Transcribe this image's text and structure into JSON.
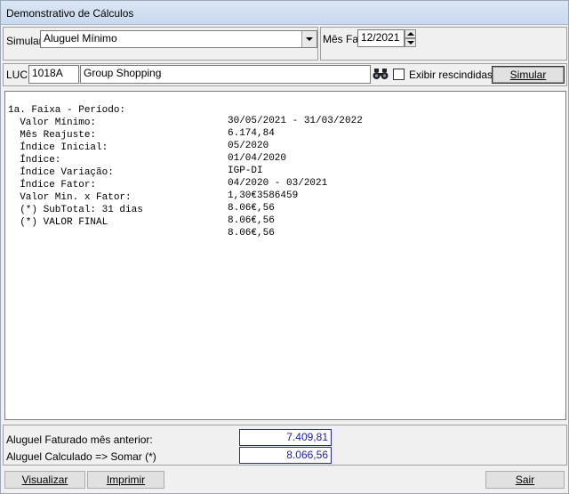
{
  "window": {
    "title": "Demonstrativo de Cálculos"
  },
  "simular": {
    "label": "Simular",
    "selected": "Aluguel Mínimo",
    "mes_fat_label": "Mês Fat",
    "mes_fat_value": "12/2021"
  },
  "luc": {
    "label": "LUC",
    "code": "1018A",
    "name": "Group Shopping",
    "exibir_rescindidas_label": "Exibir rescindidas",
    "exibir_rescindidas_checked": false,
    "simular_button": "Simular"
  },
  "report": {
    "rows": [
      {
        "key": "1a. Faixa - Período:",
        "value": "30/05/2021 - 31/03/2022"
      },
      {
        "key": "  Valor Mínimo:",
        "value": "6.174,84"
      },
      {
        "key": "  Mês Reajuste:",
        "value": "05/2020"
      },
      {
        "key": "  Índice Inicial:",
        "value": "01/04/2020"
      },
      {
        "key": "  Índice:",
        "value": "IGP-DI"
      },
      {
        "key": "  Índice Variação:",
        "value": "04/2020 - 03/2021"
      },
      {
        "key": "  Índice Fator:",
        "value": "1,30€3586459"
      },
      {
        "key": "  Valor Min. x Fator:",
        "value": "8.06€,56"
      },
      {
        "key": "  (*) SubTotal: 31 dias",
        "value": "8.06€,56"
      },
      {
        "key": "  (*) VALOR FINAL",
        "value": "8.06€,56"
      }
    ]
  },
  "totals": {
    "faturado_label": "Aluguel Faturado mês anterior:",
    "faturado_value": "7.409,81",
    "calculado_label": "Aluguel Calculado => Somar (*)",
    "calculado_value": "8.066,56"
  },
  "footer": {
    "visualizar": "Visualizar",
    "imprimir": "Imprimir",
    "sair": "Sair"
  },
  "colors": {
    "accent_value": "#1a1aa8",
    "title_bg": "#c9d9ee"
  },
  "icons": {
    "search": "binoculars-icon"
  }
}
